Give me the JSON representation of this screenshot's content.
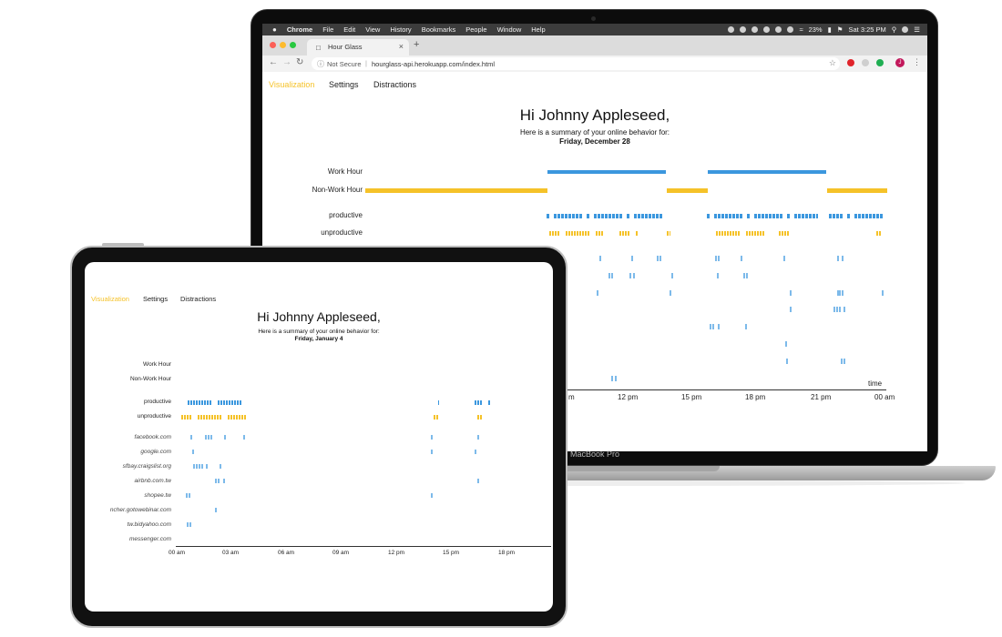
{
  "laptop": {
    "menubar": {
      "apple": "",
      "items": [
        "Chrome",
        "File",
        "Edit",
        "View",
        "History",
        "Bookmarks",
        "People",
        "Window",
        "Help"
      ],
      "battery": "23%",
      "clock": "Sat 3:25 PM"
    },
    "browser": {
      "tab_title": "Hour Glass",
      "new_tab": "+",
      "security": "Not Secure",
      "url": "hourglass-api.herokuapp.com/index.html",
      "profile_initial": "J"
    },
    "nav": {
      "items": [
        "Visualization",
        "Settings",
        "Distractions"
      ],
      "active": "Visualization"
    },
    "greeting": "Hi Johnny Appleseed,",
    "subtitle": "Here is a summary of your online behavior for:",
    "date": "Friday, December 28",
    "rows": {
      "work": "Work Hour",
      "nonwork": "Non-Work Hour",
      "productive": "productive",
      "unproductive": "unproductive"
    },
    "axis": {
      "title": "time",
      "ticks": [
        "m",
        "12 pm",
        "15 pm",
        "18 pm",
        "21 pm",
        "00 am"
      ]
    },
    "brand": "MacBook Pro"
  },
  "tablet": {
    "nav": {
      "items": [
        "Visualization",
        "Settings",
        "Distractions"
      ],
      "active": "Visualization"
    },
    "greeting": "Hi Johnny Appleseed,",
    "subtitle": "Here is a summary of your online behavior for:",
    "date": "Friday, January 4",
    "rows": {
      "work": "Work Hour",
      "nonwork": "Non-Work Hour",
      "productive": "productive",
      "unproductive": "unproductive"
    },
    "sites": [
      "facebook.com",
      "google.com",
      "sfbay.craigslist.org",
      "airbnb.com.tw",
      "shopee.tw",
      "ncher.gotowebinar.com",
      "tw.bidyahoo.com",
      "messenger.com"
    ],
    "axis": {
      "ticks": [
        "00 am",
        "03 am",
        "06 am",
        "09 am",
        "12 pm",
        "15 pm",
        "18 pm"
      ]
    }
  },
  "colors": {
    "work": "#3b97de",
    "nonwork": "#f5c229",
    "productive": "#3b97de",
    "unproductive": "#f5c229",
    "site_tick": "#6fb2e8"
  }
}
